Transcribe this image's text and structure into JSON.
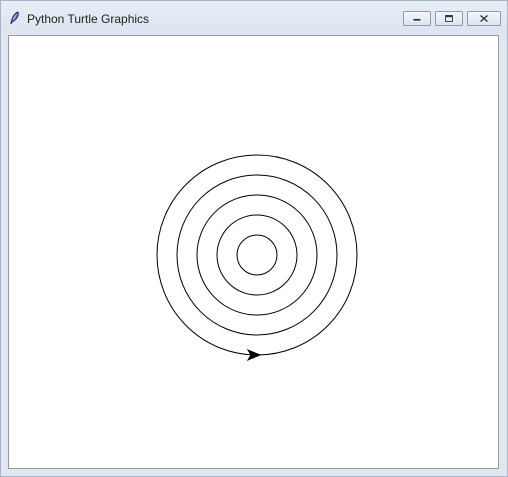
{
  "window": {
    "title": "Python Turtle Graphics",
    "icon": "feather-icon",
    "controls": {
      "minimize": "minimize-icon",
      "maximize": "restore-icon",
      "close": "close-icon"
    }
  },
  "canvas": {
    "background": "#ffffff",
    "stroke": "#000000",
    "drawing": "concentric-circles",
    "circle_count": 5,
    "turtle_icon": "turtle-arrow-icon",
    "turtle_heading": "east"
  }
}
